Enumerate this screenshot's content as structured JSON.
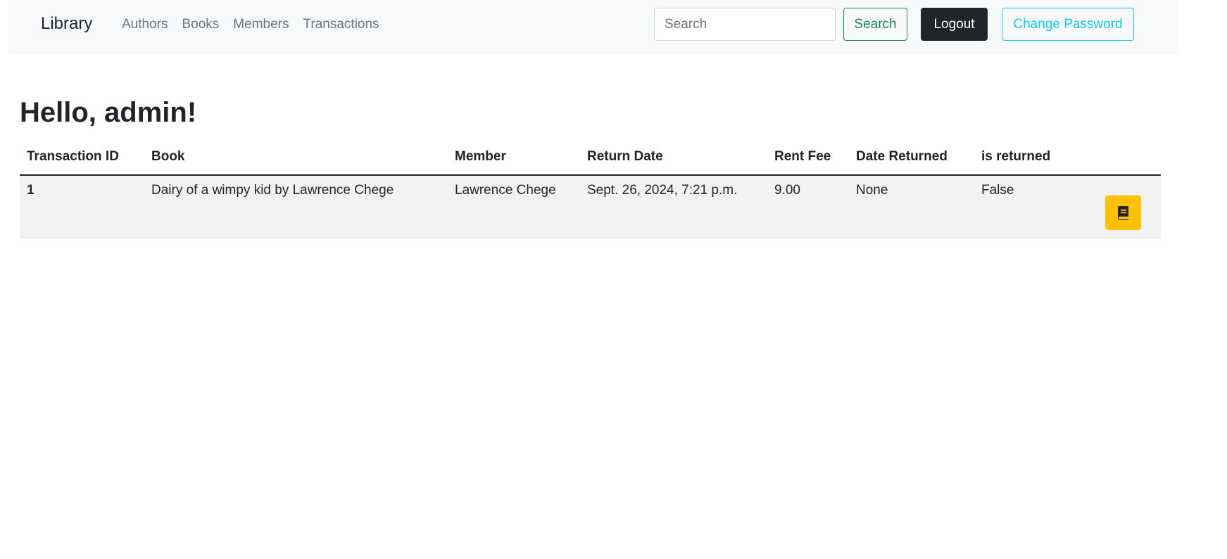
{
  "navbar": {
    "brand": "Library",
    "links": [
      "Authors",
      "Books",
      "Members",
      "Transactions"
    ],
    "search_placeholder": "Search",
    "search_button": "Search",
    "logout_button": "Logout",
    "change_password_button": "Change Password"
  },
  "page": {
    "greeting": "Hello, admin!"
  },
  "table": {
    "headers": [
      "Transaction ID",
      "Book",
      "Member",
      "Return Date",
      "Rent Fee",
      "Date Returned",
      "is returned"
    ],
    "rows": [
      {
        "transaction_id": "1",
        "book": "Dairy of a wimpy kid by Lawrence Chege",
        "member": "Lawrence Chege",
        "return_date": "Sept. 26, 2024, 7:21 p.m.",
        "rent_fee": "9.00",
        "date_returned": "None",
        "is_returned": "False",
        "action_icon": "book-icon"
      }
    ]
  },
  "colors": {
    "navbar_bg": "#f8f9fa",
    "success": "#198754",
    "dark": "#212529",
    "info": "#0dcaf0",
    "warning": "#ffc107",
    "row_bg": "#f2f2f2"
  }
}
